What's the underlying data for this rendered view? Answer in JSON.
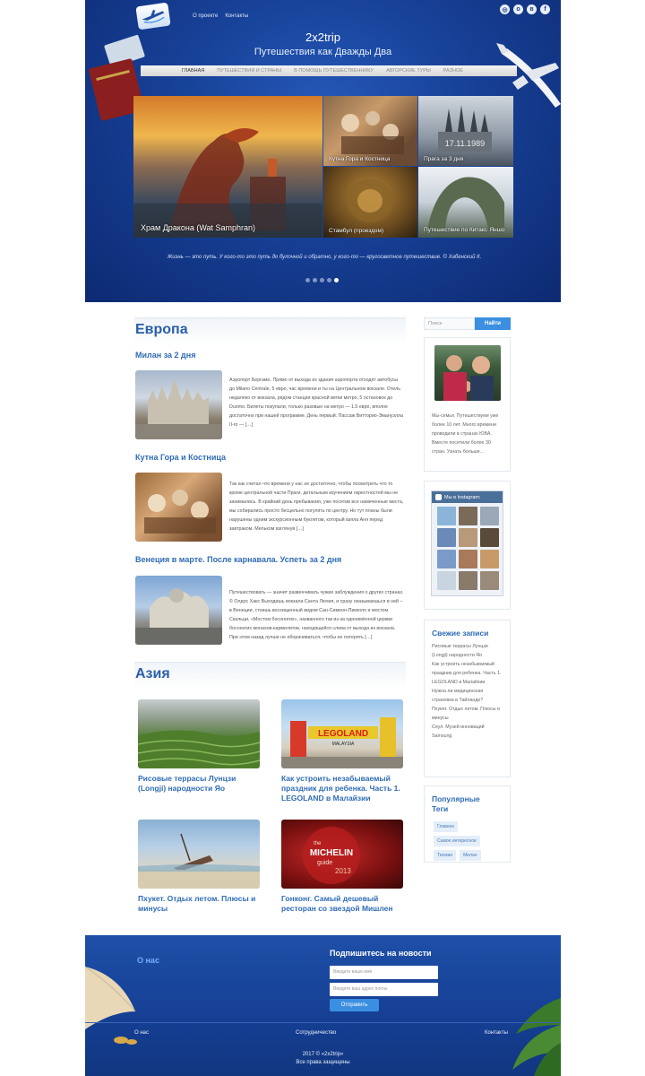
{
  "header": {
    "site_title": "2x2trip",
    "site_subtitle": "Путешествия как Дважды Два",
    "top_links": [
      "О проекте",
      "Контакты"
    ],
    "social_icons": [
      "instagram-icon",
      "odnoklassniki-icon",
      "vk-icon",
      "facebook-icon"
    ],
    "nav": [
      {
        "label": "ГЛАВНАЯ",
        "active": true
      },
      {
        "label": "ПУТЕШЕСТВИЯ И СТРАНЫ",
        "active": false
      },
      {
        "label": "В ПОМОЩЬ ПУТЕШЕСТВЕННИКУ",
        "active": false
      },
      {
        "label": "АВТОРСКИЕ ТУРЫ",
        "active": false
      },
      {
        "label": "РАЗНОЕ",
        "active": false
      }
    ],
    "slides": [
      {
        "caption": "Храм Дракона (Wat Samphran)"
      },
      {
        "caption": "Кутна Гора и Костница"
      },
      {
        "caption": "Прага за 3 дня"
      },
      {
        "caption": "Стамбул (проездом)"
      },
      {
        "caption": "Путешествие по Китаю. Яншо"
      }
    ],
    "stamp_text": "17.11.1989",
    "quote": "Жизнь — это путь. У кого-то это путь до булочной и обратно, у кого-то — кругосветное путешествие. © Хабенский К.",
    "dots_count": 5,
    "active_dot": 5
  },
  "europe": {
    "title": "Европа",
    "posts": [
      {
        "title": "Милан за 2 дня",
        "excerpt": "Аэропорт Бергамо. Прямо от выхода из здания аэропорта отходят автобусы до Milano Centrale, 5 евро, час времени и ты на Центральном вокзале. Отель недалеко от вокзала, рядом станция красной ветки метро, 5 остановок до Duomo. Билеты покупали, только разовые на метро — 1.5 евро, вполне достаточно при нашей программе. День первый. Пассаж Витторио-Эмануэлла II-го — […]"
      },
      {
        "title": "Кутна Гора и Костница",
        "excerpt": "Так как считал что времени у нас не достаточно, чтобы посмотреть что то кроме центральной части Праги, детальным изучением окрестностей мы не занимались. В крайний день пребывания, уже посетив все намеченные места, мы собирались просто бесцельно погулять по центру. Но тут планы были нарушены одним экскурсионным буклетом, который взяла Аня перед завтраком. Мельком взглянув […]"
      },
      {
        "title": "Венеция в марте.  После карнавала. Успеть за 2 дня",
        "excerpt": "Путешествовать — значит развенчивать чужие заблуждения о других странах. © Олдос Хакс Выходишь вокзала Санта Лючия, и сразу оказываешься в ней – в Венеции, стоишь восхищенный видом Сан-Симеон-Пикколо и мостом Скальци, «Мостом босоногих», названного так из-за одноимённой церкви босоногих монахов-кармелитов, находящейся слева от выхода из вокзала. При этом назад лучше не оборачиваться, чтобы не потерять […]"
      }
    ]
  },
  "asia": {
    "title": "Азия",
    "posts": [
      {
        "title": "Рисовые террасы Лунцзи (Longji) народности Яо"
      },
      {
        "title": "Как устроить незабываемый праздник для ребенка. Часть 1. LEGOLAND в Малайзии"
      },
      {
        "title": "Пхукет. Отдых летом. Плюсы и минусы"
      },
      {
        "title": "Гонконг. Самый дешевый ресторан со звездой Мишлен"
      }
    ],
    "legoland_sign": "LEGOLAND",
    "legoland_sub": "MALAYSIA",
    "michelin_line1": "the",
    "michelin_line2": "MICHELIN",
    "michelin_line3": "guide",
    "michelin_year": "2013"
  },
  "sidebar": {
    "search_placeholder": "Поиск",
    "search_button": "Найти",
    "about_text": "Мы-семья. Путешествуем уже более 10 лет. Много времени проводили в странах ЮВА. Вместе посетили более 30 стран. Узнать больше…",
    "instagram_title": "Мы в Instagram:",
    "recent_title": "Свежие записи",
    "recent_posts": [
      "Рисовые террасы Лунцзи (Longji) народности Яо",
      "Как устроить незабываемый праздник для ребенка. Часть 1. LEGOLAND в Малайзии",
      "Нужна ли медицинская страховка в Тайланде?",
      "Пхукет. Отдых летом. Плюсы и минусы",
      "Сеул. Музей инноваций Samsung"
    ],
    "tags_title": "Популярные Теги",
    "tags": [
      "Главное",
      "Самое интересное",
      "Тисман",
      "Милан"
    ]
  },
  "footer": {
    "about_title": "О нас",
    "subscribe_title": "Подпишитесь на новости",
    "name_placeholder": "Введите ваше имя",
    "email_placeholder": "Введите ваш адрес почты",
    "submit_label": "Отправить",
    "links": [
      "О нас",
      "Сотрудничество",
      "Контакты"
    ],
    "copyright": "2017 © «2x2trip»",
    "rights": "Все права защищены"
  }
}
